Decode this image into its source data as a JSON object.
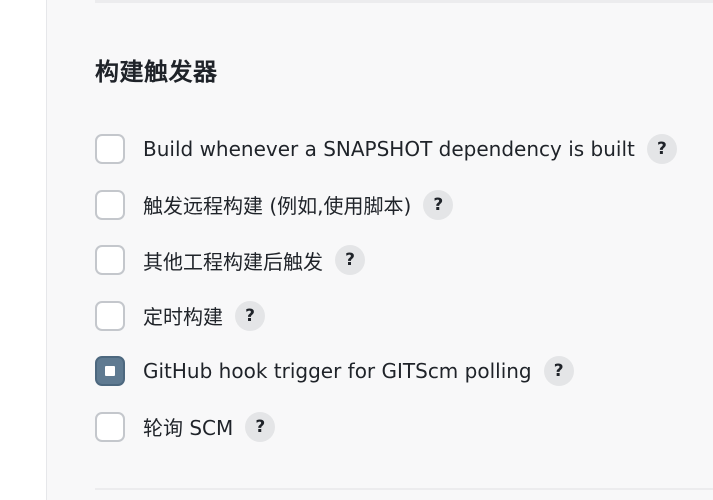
{
  "section": {
    "title": "构建触发器"
  },
  "triggers": [
    {
      "label": "Build whenever a SNAPSHOT dependency is built",
      "checked": false,
      "help": "?"
    },
    {
      "label": "触发远程构建 (例如,使用脚本)",
      "checked": false,
      "help": "?"
    },
    {
      "label": "其他工程构建后触发",
      "checked": false,
      "help": "?"
    },
    {
      "label": "定时构建",
      "checked": false,
      "help": "?"
    },
    {
      "label": "GitHub hook trigger for GITScm polling",
      "checked": true,
      "help": "?"
    },
    {
      "label": "轮询 SCM",
      "checked": false,
      "help": "?"
    }
  ],
  "colors": {
    "checked_fill": "#5f7a91",
    "panel_bg": "#f8f8f9",
    "help_bg": "#e4e5e7"
  }
}
